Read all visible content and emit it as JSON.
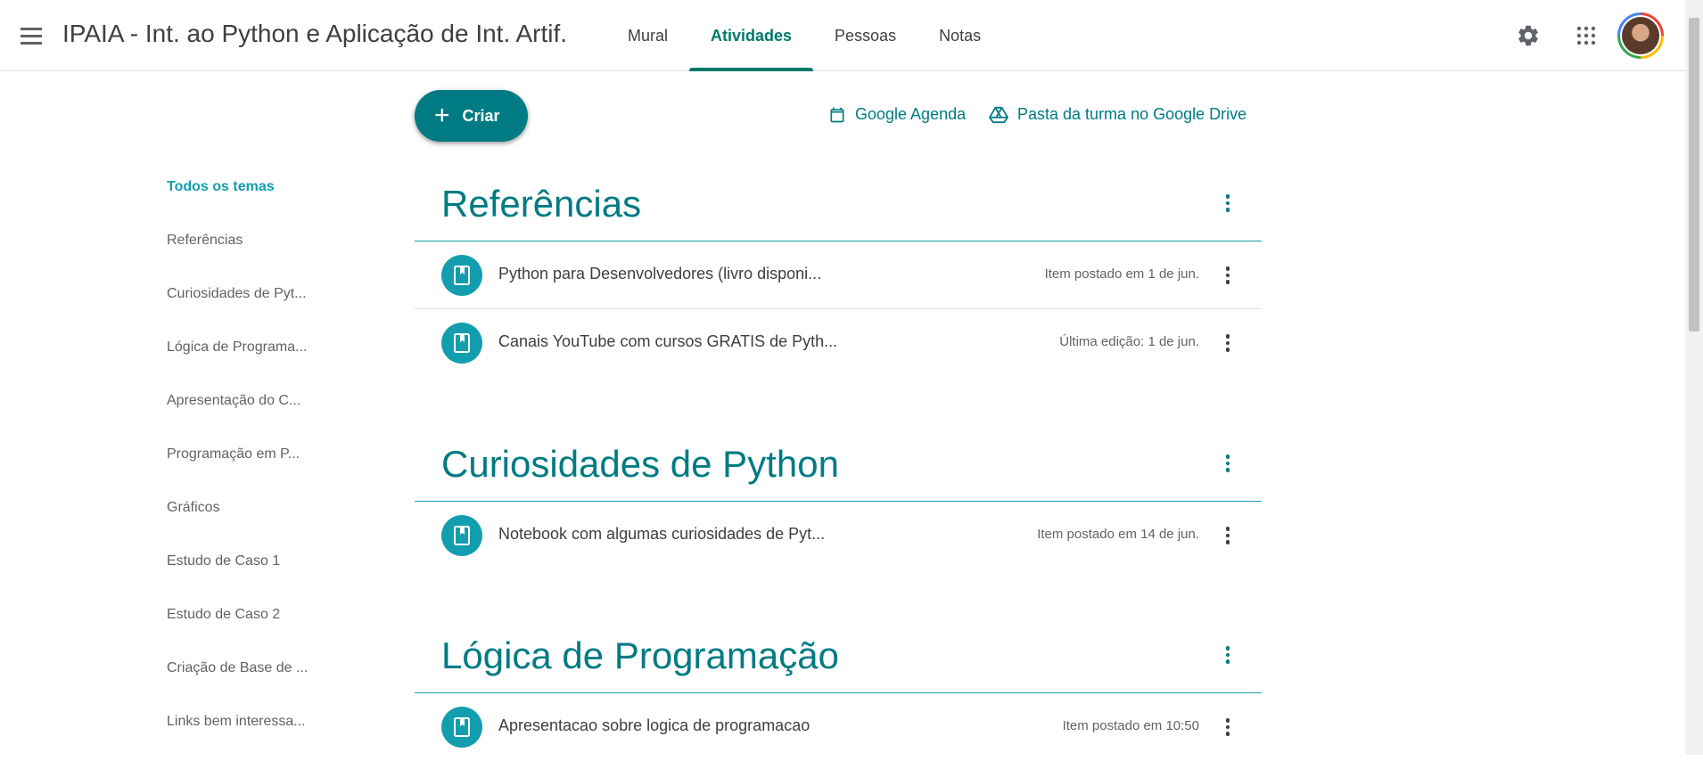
{
  "header": {
    "class_title": "IPAIA - Int. ao Python e Aplicação de Int. Artif.",
    "tabs": [
      {
        "label": "Mural"
      },
      {
        "label": "Atividades"
      },
      {
        "label": "Pessoas"
      },
      {
        "label": "Notas"
      }
    ],
    "active_tab": "Atividades"
  },
  "toolbar": {
    "create_label": "Criar",
    "calendar_label": "Google Agenda",
    "drive_label": "Pasta da turma no Google Drive"
  },
  "sidebar": {
    "items": [
      {
        "label": "Todos os temas"
      },
      {
        "label": "Referências"
      },
      {
        "label": "Curiosidades de Pyt..."
      },
      {
        "label": "Lógica de Programa..."
      },
      {
        "label": "Apresentação do C..."
      },
      {
        "label": "Programação em P..."
      },
      {
        "label": "Gráficos"
      },
      {
        "label": "Estudo de Caso 1"
      },
      {
        "label": "Estudo de Caso 2"
      },
      {
        "label": "Criação de Base de ..."
      },
      {
        "label": "Links bem interessa..."
      }
    ]
  },
  "topics": [
    {
      "title": "Referências",
      "items": [
        {
          "title": "Python para Desenvolvedores (livro disponi...",
          "date": "Item postado em 1 de jun."
        },
        {
          "title": "Canais YouTube com cursos GRATIS de Pyth...",
          "date": "Última edição: 1 de jun."
        }
      ]
    },
    {
      "title": "Curiosidades de Python",
      "items": [
        {
          "title": "Notebook com algumas curiosidades de Pyt...",
          "date": "Item postado em 14 de jun."
        }
      ]
    },
    {
      "title": "Lógica de Programação",
      "items": [
        {
          "title": "Apresentacao sobre logica de programacao",
          "date": "Item postado em 10:50"
        }
      ]
    }
  ],
  "colors": {
    "accent": "#007b83",
    "accent_light": "#129eaf",
    "text": "#3c4043",
    "muted": "#5f6368"
  }
}
